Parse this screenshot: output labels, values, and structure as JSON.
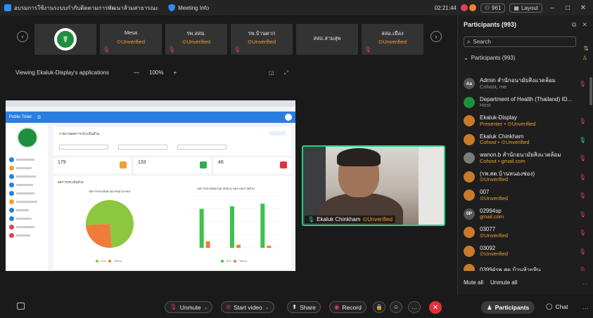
{
  "titlebar": {
    "app_title": "อบรมการใช้งานระบบกำกับติดตามการพัฒนาส้วมสาธารณะ",
    "meeting_info": "Meeting Info",
    "clock": "02:21:44",
    "viewer_count": "961",
    "layout_label": "Layout"
  },
  "strip": {
    "prev_arrow": "‹",
    "next_arrow": "›",
    "thumbs": [
      {
        "name": "Mesa",
        "status": "⊙Unverified"
      },
      {
        "name": "รพ.สสม.",
        "status": "⊙Unverified"
      },
      {
        "name": "รพ.บ้านตาก",
        "status": "⊙Unverified"
      },
      {
        "name": "สสอ.สามสุพ",
        "status": ""
      },
      {
        "name": "สสอ.เมือง",
        "status": "⊙Unverified"
      }
    ]
  },
  "viewbar": {
    "label": "Viewing Ekaluk-Display's applications",
    "zoom_out": "—",
    "zoom_value": "100%",
    "zoom_in": "+"
  },
  "share": {
    "app_name": "Public Toilet",
    "filter_title": "รายงานผลการประเมินส้วม",
    "kpis": [
      {
        "value": "179",
        "icon_color": "#f0a030"
      },
      {
        "value": "133",
        "icon_color": "#2fae4f"
      },
      {
        "value": "46",
        "icon_color": "#e0303e"
      }
    ],
    "chart_section": "ผลการประเมินส้วม",
    "pie_title": "ผลการประเมินตามมาตรฐาน HAS",
    "bar_title": "ผลการประเมินตามมาตรฐาน HAS แยกรายด้าน"
  },
  "chart_data": [
    {
      "type": "pie",
      "categories": [
        "ผ่าน",
        "ไม่ผ่าน"
      ],
      "values": [
        74.3,
        25.7
      ],
      "colors": [
        "#8dc63f",
        "#ee7d3b"
      ],
      "title": "ผลการประเมินตามมาตรฐาน HAS"
    },
    {
      "type": "bar",
      "title": "ผลการประเมินตามมาตรฐาน HAS แยกรายด้าน",
      "categories": [
        "ด้าน1",
        "ด้าน2",
        "ด้าน3"
      ],
      "series": [
        {
          "name": "ผ่าน",
          "values": [
            150,
            160,
            170
          ],
          "color": "#3cc34a"
        },
        {
          "name": "ไม่ผ่าน",
          "values": [
            25,
            12,
            8
          ],
          "color": "#ee7d3b"
        }
      ],
      "ylim": [
        0,
        200
      ]
    }
  ],
  "video": {
    "name": "Ekaluk Chinkham",
    "status": "⊙Unverified"
  },
  "panel": {
    "title": "Participants (993)",
    "search_placeholder": "Search",
    "group_label": "Participants (993)",
    "participants": [
      {
        "initials": "Aa",
        "avatar_color": "#555555",
        "name": "Admin สำนักอนามัยสิ่งแวดล้อม",
        "role": "Cohost, me",
        "role_style": "plain",
        "mic": "red"
      },
      {
        "initials": "",
        "avatar_color": "#1e8f3e",
        "name": "Department of Health (Thailand) ID...",
        "role": "Host",
        "role_style": "plain",
        "mic": "none"
      },
      {
        "initials": "",
        "avatar_color": "#c97a2a",
        "name": "Ekaluk-Display",
        "role": "Presenter • ⊙Unverified",
        "role_style": "unverified",
        "mic": "red"
      },
      {
        "initials": "",
        "avatar_color": "#c97a2a",
        "name": "Ekaluk Chinkham",
        "role": "Cohost • ⊙Unverified",
        "role_style": "unverified",
        "mic": "green"
      },
      {
        "initials": "",
        "avatar_color": "#7a7a7a",
        "name": "wanon.b สำนักอนามัยสิ่งแวดล้อม",
        "role": "Cohost • gmail.com",
        "role_style": "mail",
        "mic": "red"
      },
      {
        "initials": "",
        "avatar_color": "#c97a2a",
        "name": "(รพ.สต.บ้านหนองช่อง)",
        "role": "⊙Unverified",
        "role_style": "unverified",
        "mic": "red"
      },
      {
        "initials": "",
        "avatar_color": "#c97a2a",
        "name": "007",
        "role": "⊙Unverified",
        "role_style": "unverified",
        "mic": "red"
      },
      {
        "initials": "0P",
        "avatar_color": "#555555",
        "name": "02994sp",
        "role": "gmail.com",
        "role_style": "mail",
        "mic": "red"
      },
      {
        "initials": "",
        "avatar_color": "#c97a2a",
        "name": "03077",
        "role": "⊙Unverified",
        "role_style": "unverified",
        "mic": "red"
      },
      {
        "initials": "",
        "avatar_color": "#c97a2a",
        "name": "03092",
        "role": "⊙Unverified",
        "role_style": "unverified",
        "mic": "red"
      },
      {
        "initials": "",
        "avatar_color": "#c97a2a",
        "name": "03994รพ.สต.บ้านห้วยหิน",
        "role": "",
        "role_style": "plain",
        "mic": "red"
      }
    ],
    "mute_all": "Mute all",
    "unmute_all": "Unmute all"
  },
  "toolbar": {
    "unmute": "Unmute",
    "start_video": "Start video",
    "share": "Share",
    "record": "Record",
    "participants": "Participants",
    "chat": "Chat"
  }
}
